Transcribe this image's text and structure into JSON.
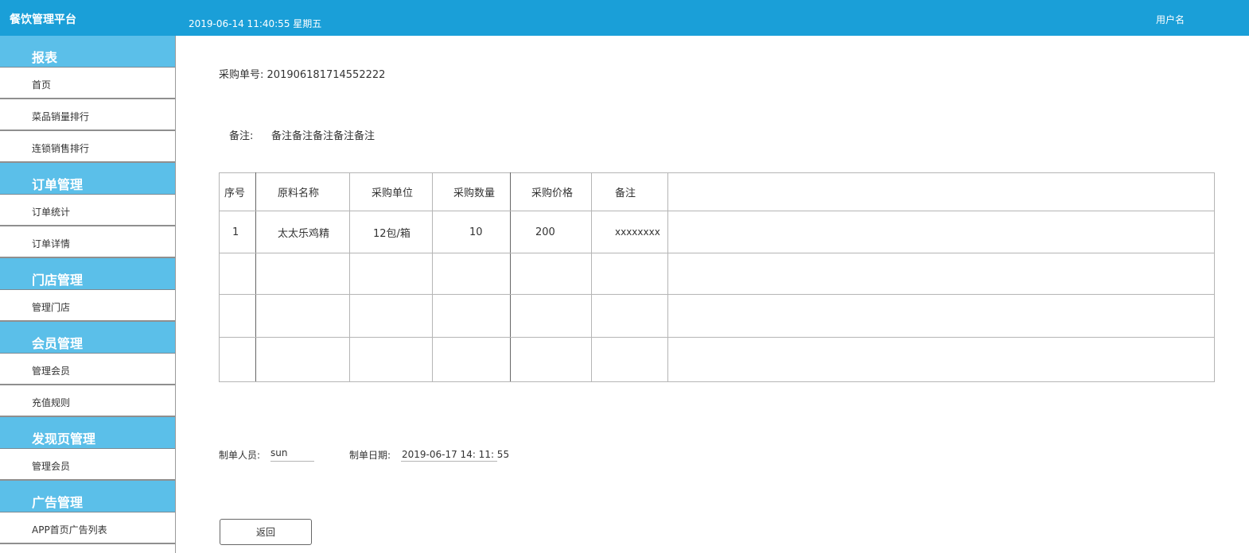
{
  "header": {
    "brand": "餐饮管理平台",
    "datetime": "2019-06-14 11:40:55 星期五",
    "username": "用户名"
  },
  "sidebar": {
    "sections": [
      {
        "title": "报表",
        "items": [
          "首页",
          "菜品销量排行",
          "连锁销售排行"
        ]
      },
      {
        "title": "订单管理",
        "items": [
          "订单统计",
          "订单详情"
        ]
      },
      {
        "title": "门店管理",
        "items": [
          "管理门店"
        ]
      },
      {
        "title": "会员管理",
        "items": [
          "管理会员",
          "充值规则"
        ]
      },
      {
        "title": "发现页管理",
        "items": [
          "管理会员"
        ]
      },
      {
        "title": "广告管理",
        "items": [
          "APP首页广告列表"
        ]
      }
    ]
  },
  "order": {
    "number_label": "采购单号",
    "number_value": "201906181714552222",
    "remark_label": "备注:",
    "remark_value": "备注备注备注备注备注"
  },
  "table": {
    "headers": [
      "序号",
      "原料名称",
      "采购单位",
      "采购数量",
      "采购价格",
      "备注",
      ""
    ],
    "rows": [
      [
        "1",
        "太太乐鸡精",
        "12包/箱",
        "10",
        "200",
        "xxxxxxxx",
        ""
      ],
      [
        "",
        "",
        "",
        "",
        "",
        "",
        ""
      ],
      [
        "",
        "",
        "",
        "",
        "",
        "",
        ""
      ],
      [
        "",
        "",
        "",
        "",
        "",
        "",
        ""
      ]
    ]
  },
  "footer": {
    "creator_label": "制单人员:",
    "creator_value": "sun",
    "date_label": "制单日期:",
    "date_value": "2019-06-17 14:  11:  55"
  },
  "back_button": "返回"
}
